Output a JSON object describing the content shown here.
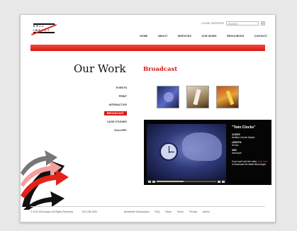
{
  "logo": {
    "line1": "KELL",
    "line2": "IMPACT"
  },
  "utility": {
    "links": "LOGIN | REGISTER",
    "search_placeholder": "SEARCH",
    "go_label": "»"
  },
  "nav": {
    "items": [
      "HOME",
      "ABOUT",
      "SERVICES",
      "OUR WORK",
      "RESOURCES",
      "CONTACT"
    ]
  },
  "colors": {
    "accent": "#d51d15"
  },
  "page": {
    "title": "Our Work",
    "section": "Broadcast"
  },
  "subnav": {
    "items": [
      {
        "label": "EVENTS",
        "active": false
      },
      {
        "label": "PRINT",
        "active": false
      },
      {
        "label": "INTERACTIVE",
        "active": false
      },
      {
        "label": "BROADCAST",
        "active": true
      },
      {
        "label": "CASE STUDIES",
        "active": false
      },
      {
        "label": "GALLERY",
        "active": false
      }
    ]
  },
  "video": {
    "title": "\"Twin Clocks\"",
    "client_label": "CLIENT:",
    "client_value": "Another Lincoln Airport",
    "length_label": "LENGTH:",
    "length_value": "30 sec.",
    "use_label": "USE:",
    "use_value": "local spot",
    "note_prefix": "If you can't see the video,",
    "note_link": "click here",
    "note_suffix": "to download the latest flash player",
    "progress": 0.45
  },
  "footer": {
    "copyright": "© 2010 Kell Impact. All Rights Reserved.",
    "phone": "814.765.1000",
    "links": [
      "Newsletter Subscription",
      "FAQ",
      "News",
      "Terms",
      "Privacy",
      "Admin"
    ]
  }
}
